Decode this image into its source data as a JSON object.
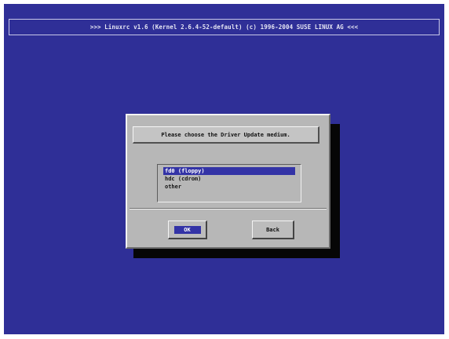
{
  "header": {
    "title": ">>> Linuxrc v1.6 (Kernel 2.6.4-52-default) (c) 1996-2004 SUSE LINUX AG <<<"
  },
  "dialog": {
    "prompt": "Please choose the Driver Update medium.",
    "options": [
      "fd0 (floppy)",
      "hdc (cdrom)",
      "other"
    ],
    "selected_option": "fd0 (floppy)",
    "buttons": {
      "ok_label": "OK",
      "back_label": "Back"
    }
  },
  "colors": {
    "background": "#2f2f97",
    "dialog": "#b7b7b7",
    "selection": "#3333a6",
    "shadow": "#060606"
  }
}
